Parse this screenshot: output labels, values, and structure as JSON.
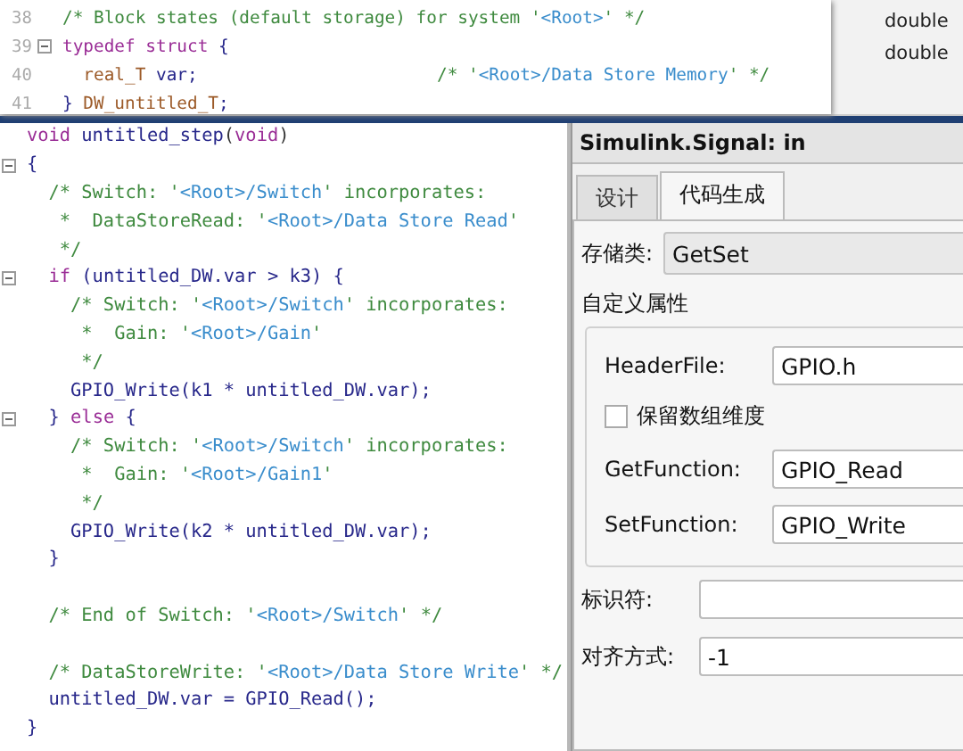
{
  "snippet": {
    "lines": [
      {
        "number": "38",
        "collapsible": false,
        "tokens": [
          {
            "kind": "cm",
            "text": "/* Block states (default storage) for system '"
          },
          {
            "kind": "ref",
            "text": "<Root>"
          },
          {
            "kind": "cm",
            "text": "' */"
          }
        ]
      },
      {
        "number": "39",
        "collapsible": true,
        "tokens": [
          {
            "kind": "kw",
            "text": "typedef struct "
          },
          {
            "kind": "id",
            "text": "{"
          }
        ]
      },
      {
        "number": "40",
        "collapsible": false,
        "tokens": [
          {
            "kind": "ty",
            "text": "  real_T "
          },
          {
            "kind": "id",
            "text": "var;                       "
          },
          {
            "kind": "cm",
            "text": "/* '"
          },
          {
            "kind": "ref",
            "text": "<Root>/Data Store Memory"
          },
          {
            "kind": "cm",
            "text": "' */"
          }
        ]
      },
      {
        "number": "41",
        "collapsible": false,
        "tokens": [
          {
            "kind": "id",
            "text": "} "
          },
          {
            "kind": "ty",
            "text": "DW_untitled_T"
          },
          {
            "kind": "id",
            "text": ";"
          }
        ]
      }
    ]
  },
  "background_cells": [
    "double",
    "double"
  ],
  "editor": {
    "lines": [
      {
        "collapsible": false,
        "tokens": [
          {
            "kind": "kw",
            "text": "void "
          },
          {
            "kind": "id",
            "text": "untitled_step"
          },
          {
            "kind": "pl",
            "text": "("
          },
          {
            "kind": "kw",
            "text": "void"
          },
          {
            "kind": "pl",
            "text": ")"
          }
        ]
      },
      {
        "collapsible": true,
        "tokens": [
          {
            "kind": "id",
            "text": "{"
          }
        ]
      },
      {
        "collapsible": false,
        "tokens": [
          {
            "kind": "cm",
            "text": "  /* Switch: '"
          },
          {
            "kind": "ref",
            "text": "<Root>/Switch"
          },
          {
            "kind": "cm",
            "text": "' incorporates:"
          }
        ]
      },
      {
        "collapsible": false,
        "tokens": [
          {
            "kind": "cm",
            "text": "   *  DataStoreRead: '"
          },
          {
            "kind": "ref",
            "text": "<Root>/Data Store Read"
          },
          {
            "kind": "cm",
            "text": "'"
          }
        ]
      },
      {
        "collapsible": false,
        "tokens": [
          {
            "kind": "cm",
            "text": "   */"
          }
        ]
      },
      {
        "collapsible": true,
        "tokens": [
          {
            "kind": "kw",
            "text": "  if "
          },
          {
            "kind": "id",
            "text": "(untitled_DW.var > k3) {"
          }
        ]
      },
      {
        "collapsible": false,
        "tokens": [
          {
            "kind": "cm",
            "text": "    /* Switch: '"
          },
          {
            "kind": "ref",
            "text": "<Root>/Switch"
          },
          {
            "kind": "cm",
            "text": "' incorporates:"
          }
        ]
      },
      {
        "collapsible": false,
        "tokens": [
          {
            "kind": "cm",
            "text": "     *  Gain: '"
          },
          {
            "kind": "ref",
            "text": "<Root>/Gain"
          },
          {
            "kind": "cm",
            "text": "'"
          }
        ]
      },
      {
        "collapsible": false,
        "tokens": [
          {
            "kind": "cm",
            "text": "     */"
          }
        ]
      },
      {
        "collapsible": false,
        "tokens": [
          {
            "kind": "id",
            "text": "    GPIO_Write(k1 * untitled_DW.var);"
          }
        ]
      },
      {
        "collapsible": true,
        "tokens": [
          {
            "kind": "id",
            "text": "  } "
          },
          {
            "kind": "kw",
            "text": "else "
          },
          {
            "kind": "id",
            "text": "{"
          }
        ]
      },
      {
        "collapsible": false,
        "tokens": [
          {
            "kind": "cm",
            "text": "    /* Switch: '"
          },
          {
            "kind": "ref",
            "text": "<Root>/Switch"
          },
          {
            "kind": "cm",
            "text": "' incorporates:"
          }
        ]
      },
      {
        "collapsible": false,
        "tokens": [
          {
            "kind": "cm",
            "text": "     *  Gain: '"
          },
          {
            "kind": "ref",
            "text": "<Root>/Gain1"
          },
          {
            "kind": "cm",
            "text": "'"
          }
        ]
      },
      {
        "collapsible": false,
        "tokens": [
          {
            "kind": "cm",
            "text": "     */"
          }
        ]
      },
      {
        "collapsible": false,
        "tokens": [
          {
            "kind": "id",
            "text": "    GPIO_Write(k2 * untitled_DW.var);"
          }
        ]
      },
      {
        "collapsible": false,
        "tokens": [
          {
            "kind": "id",
            "text": "  }"
          }
        ]
      },
      {
        "collapsible": false
      },
      {
        "collapsible": false,
        "tokens": [
          {
            "kind": "cm",
            "text": "  /* End of Switch: '"
          },
          {
            "kind": "ref",
            "text": "<Root>/Switch"
          },
          {
            "kind": "cm",
            "text": "' */"
          }
        ]
      },
      {
        "collapsible": false
      },
      {
        "collapsible": false,
        "tokens": [
          {
            "kind": "cm",
            "text": "  /* DataStoreWrite: '"
          },
          {
            "kind": "ref",
            "text": "<Root>/Data Store Write"
          },
          {
            "kind": "cm",
            "text": "' */"
          }
        ]
      },
      {
        "collapsible": false,
        "tokens": [
          {
            "kind": "id",
            "text": "  untitled_DW.var = GPIO_Read();"
          }
        ]
      },
      {
        "collapsible": false,
        "tokens": [
          {
            "kind": "id",
            "text": "}"
          }
        ]
      }
    ]
  },
  "dialog": {
    "title": "Simulink.Signal: in",
    "tabs": [
      {
        "label": "设计",
        "selected": false
      },
      {
        "label": "代码生成",
        "selected": true
      }
    ],
    "storage_class": {
      "label": "存储类:",
      "value": "GetSet"
    },
    "custom_attributes": {
      "title": "自定义属性",
      "items": [
        {
          "kind": "field",
          "label": "HeaderFile:",
          "value": "GPIO.h"
        },
        {
          "kind": "checkbox",
          "label": "保留数组维度",
          "checked": false
        },
        {
          "kind": "field",
          "label": "GetFunction:",
          "value": "GPIO_Read"
        },
        {
          "kind": "field",
          "label": "SetFunction:",
          "value": "GPIO_Write"
        }
      ]
    },
    "fields": [
      {
        "label": "标识符:"
      },
      {
        "label": "对齐方式:",
        "value": "-1"
      }
    ]
  }
}
